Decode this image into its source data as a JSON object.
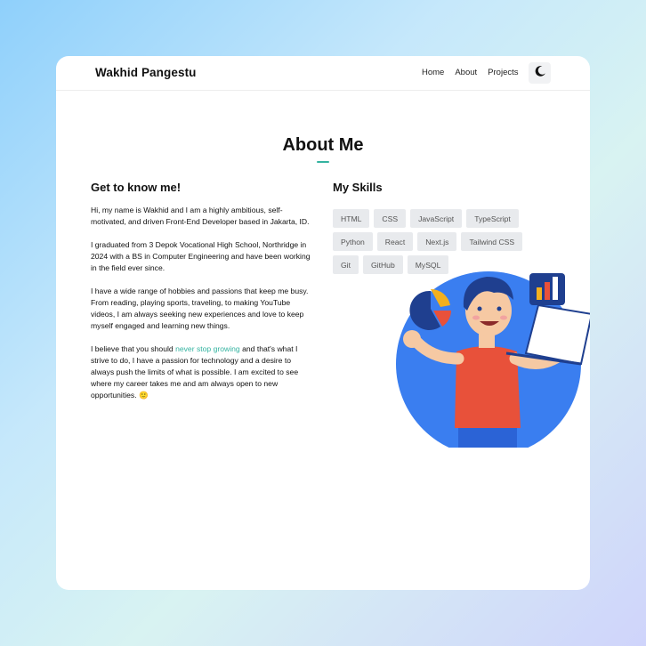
{
  "navbar": {
    "brand": "Wakhid Pangestu",
    "links": [
      {
        "label": "Home"
      },
      {
        "label": "About"
      },
      {
        "label": "Projects"
      }
    ],
    "theme_icon": "moon-icon"
  },
  "about": {
    "title": "About Me",
    "left": {
      "heading": "Get to know me!",
      "p1": "Hi, my name is Wakhid and I am a highly ambitious, self-motivated, and driven Front-End Developer based in Jakarta, ID.",
      "p2": "I graduated from 3 Depok Vocational High School, Northridge in 2024 with a BS in Computer Engineering and have been working in the field ever since.",
      "p3": "I have a wide range of hobbies and passions that keep me busy. From reading, playing sports, traveling, to making YouTube videos, I am always seeking new experiences and love to keep myself engaged and learning new things.",
      "p4_before": "I believe that you should ",
      "p4_highlight": "never stop growing",
      "p4_after": " and that's what I strive to do, I have a passion for technology and a desire to always push the limits of what is possible. I am excited to see where my career takes me and am always open to new opportunities.",
      "p4_emoji": "🙂"
    },
    "right": {
      "heading": "My Skills",
      "skills": [
        "HTML",
        "CSS",
        "JavaScript",
        "TypeScript",
        "Python",
        "React",
        "Next.js",
        "Tailwind CSS",
        "Git",
        "GitHub",
        "MySQL"
      ]
    }
  },
  "colors": {
    "accent": "#34b3a0",
    "illustration_blue": "#3a7ef0",
    "shirt": "#e8513a"
  }
}
